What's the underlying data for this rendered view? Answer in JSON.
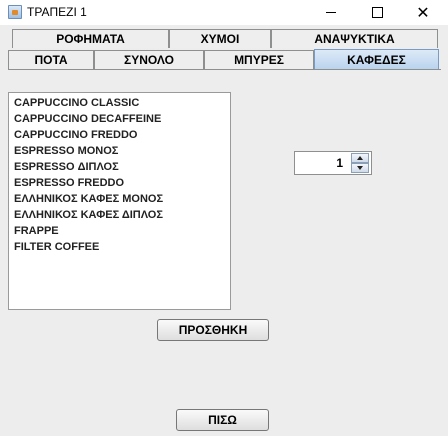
{
  "window": {
    "title": "ΤΡΑΠΕΖΙ 1",
    "close_glyph": "✕"
  },
  "tabs": {
    "row_top": [
      "ΡΟΦΗΜΑΤΑ",
      "ΧΥΜΟΙ",
      "ΑΝΑΨΥΚΤΙΚΑ"
    ],
    "row_bottom": [
      "ΠΟΤΑ",
      "ΣΥΝΟΛΟ",
      "ΜΠΥΡΕΣ",
      "ΚΑΦΕΔΕΣ"
    ],
    "selected": "ΚΑΦΕΔΕΣ"
  },
  "coffee_list": [
    "CAPPUCCINO CLASSIC",
    "CAPPUCCINO DECAFFEINE",
    "CAPPUCCINO FREDDO",
    "ESPRESSO ΜΟΝΟΣ",
    "ESPRESSO ΔΙΠΛΟΣ",
    "ESPRESSO FREDDO",
    "ΕΛΛΗΝΙΚΟΣ ΚΑΦΕΣ ΜΟΝΟΣ",
    "ΕΛΛΗΝΙΚΟΣ ΚΑΦΕΣ ΔΙΠΛΟΣ",
    "FRAPPE",
    "FILTER COFFEE"
  ],
  "quantity": {
    "value": "1"
  },
  "buttons": {
    "add": "ΠΡΟΣΘΗΚΗ",
    "back": "ΠΙΣΩ"
  }
}
